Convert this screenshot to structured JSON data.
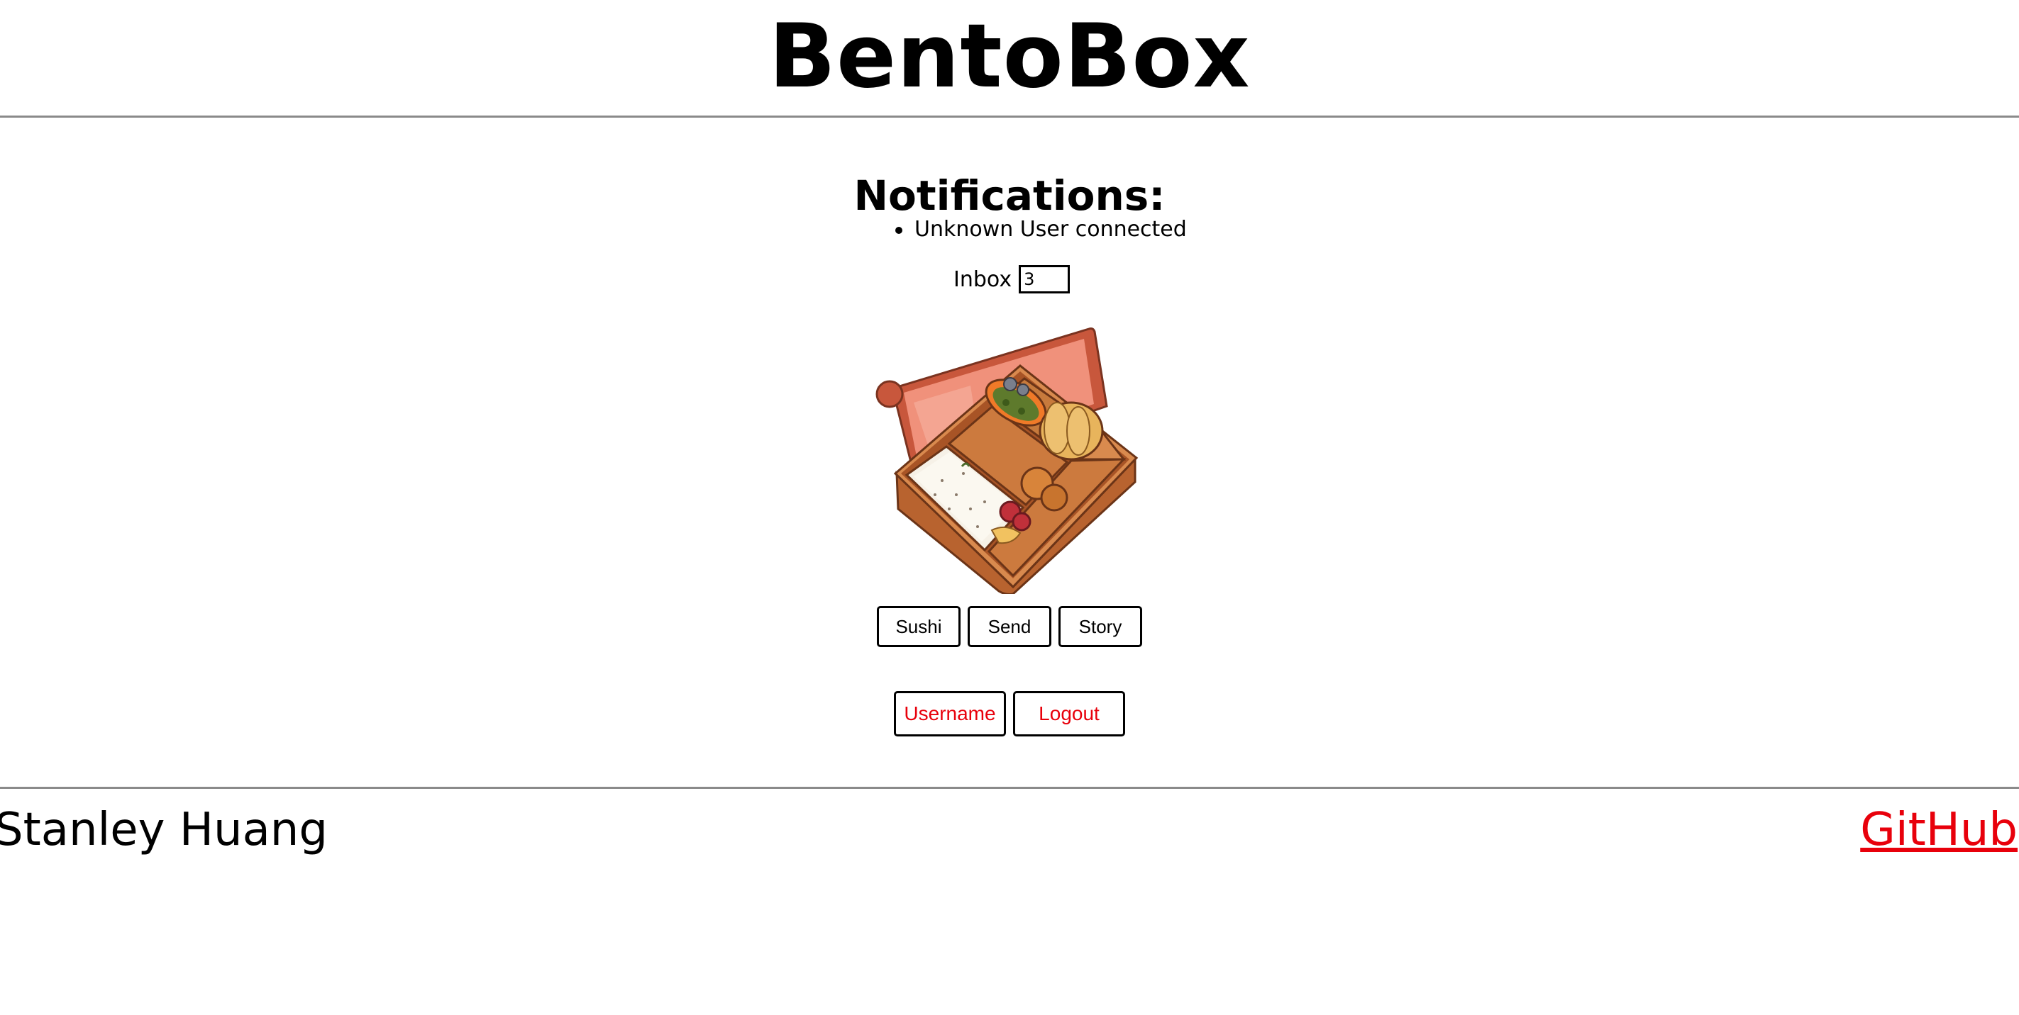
{
  "header": {
    "title": "BentoBox"
  },
  "notifications": {
    "heading": "Notifications:",
    "items": [
      "Unknown User connected"
    ]
  },
  "inbox": {
    "label": "Inbox",
    "count": "3"
  },
  "image": {
    "icon": "bento-box-icon"
  },
  "actions": {
    "sushi_label": "Sushi",
    "send_label": "Send",
    "story_label": "Story"
  },
  "account": {
    "username_label": "Username",
    "logout_label": "Logout"
  },
  "footer": {
    "author": "Stanley Huang",
    "github_label": "GitHub"
  },
  "colors": {
    "accent_red": "#e8000b",
    "rule_gray": "#8a8a8a"
  }
}
